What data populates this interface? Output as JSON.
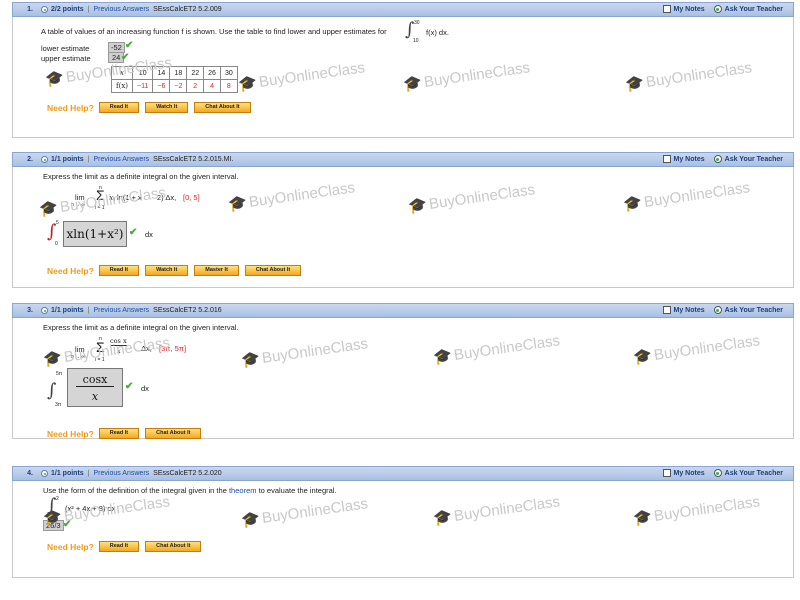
{
  "header": {
    "my_notes": "My Notes",
    "ask_teacher": "Ask Your Teacher",
    "previous_answers": "Previous Answers",
    "separator": "|"
  },
  "watermark": "BuyOnlineClass",
  "help": {
    "label": "Need Help?",
    "read_it": "Read It",
    "watch_it": "Watch It",
    "master_it": "Master It",
    "chat": "Chat About It"
  },
  "questions": [
    {
      "num": "1.",
      "points": "2/2 points",
      "code": "SEssCalcET2 5.2.009",
      "prompt": "A table of values of an increasing function f is shown. Use the table to find lower and upper estimates for",
      "integral_upper": "30",
      "integral_lower": "10",
      "integrand": "f(x) dx.",
      "lower_label": "lower estimate",
      "lower_value": "-52",
      "upper_label": "upper estimate",
      "upper_value": "24",
      "table": {
        "x_label": "x",
        "f_label": "f(x)",
        "x": [
          "10",
          "14",
          "18",
          "22",
          "26",
          "30"
        ],
        "f": [
          "−11",
          "−6",
          "−2",
          "2",
          "4",
          "8"
        ]
      }
    },
    {
      "num": "2.",
      "points": "1/1 points",
      "code": "SEssCalcET2 5.2.015.MI.",
      "prompt": "Express the limit as a definite integral on the given interval.",
      "lim": "lim",
      "lim_sub": "n → ∞",
      "sum_top": "n",
      "sum_bottom": "i = 1",
      "expr": "x",
      "expr_sub": "i",
      "expr_ln": " ln(1 + x",
      "expr_end": "2) Δx,",
      "interval": "[0, 5]",
      "int_upper": "5",
      "int_lower": "0",
      "answer": "xln(1+x²)",
      "dx": "dx"
    },
    {
      "num": "3.",
      "points": "1/1 points",
      "code": "SEssCalcET2 5.2.016",
      "prompt": "Express the limit as a definite integral on the given interval.",
      "lim": "lim",
      "lim_sub": "n → ∞",
      "sum_top": "n",
      "sum_bottom": "i = 1",
      "frac_num": "cos x",
      "frac_den": "x",
      "expr_end": "Δx,",
      "interval": "[3π, 5π]",
      "int_upper": "5π",
      "int_lower": "3π",
      "answer_num": "cosx",
      "answer_den": "x",
      "dx": "dx"
    },
    {
      "num": "4.",
      "points": "1/1 points",
      "code": "SEssCalcET2 5.2.020",
      "prompt_a": "Use the form of the definition of the integral given in the",
      "theorem": "theorem",
      "prompt_b": "to evaluate the integral.",
      "int_upper": "2",
      "int_lower": "0",
      "integrand": "(x² + 4x + 8) dx",
      "answer": "26/3"
    }
  ]
}
